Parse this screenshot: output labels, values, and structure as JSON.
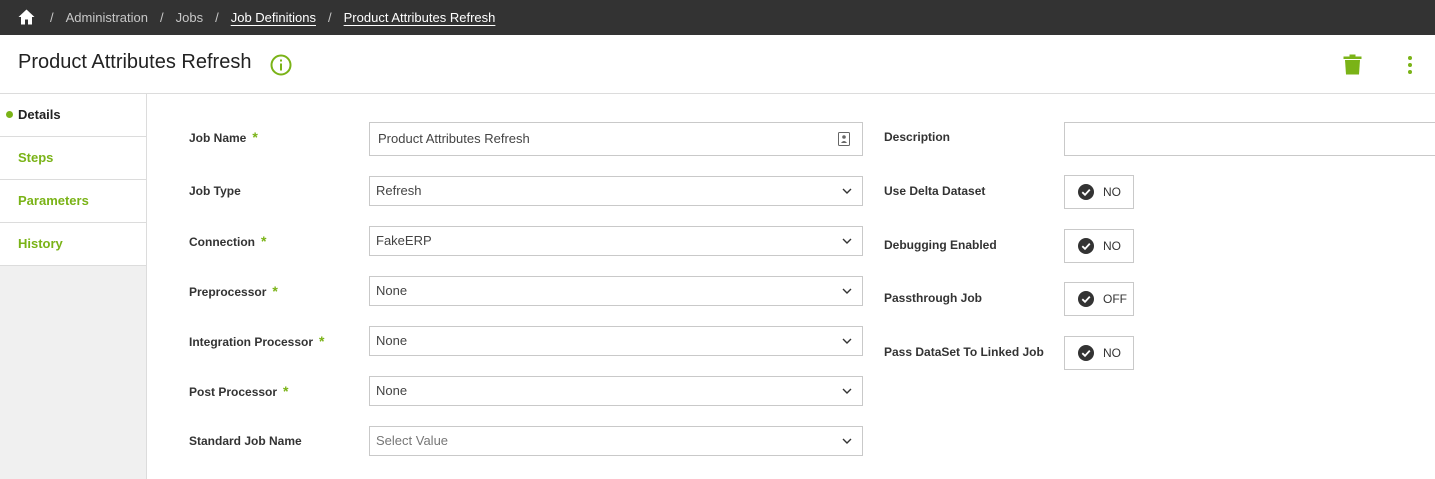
{
  "breadcrumb": {
    "items": [
      "Administration",
      "Jobs",
      "Job Definitions",
      "Product Attributes Refresh"
    ],
    "separator": "/"
  },
  "header": {
    "title": "Product Attributes Refresh"
  },
  "sidebar": {
    "items": [
      {
        "label": "Details"
      },
      {
        "label": "Steps"
      },
      {
        "label": "Parameters"
      },
      {
        "label": "History"
      }
    ]
  },
  "form": {
    "required_mark": "*",
    "job_name": {
      "label": "Job Name",
      "value": "Product Attributes Refresh"
    },
    "job_type": {
      "label": "Job Type",
      "value": "Refresh"
    },
    "connection": {
      "label": "Connection",
      "value": "FakeERP"
    },
    "preprocessor": {
      "label": "Preprocessor",
      "value": "None"
    },
    "integration_processor": {
      "label": "Integration Processor",
      "value": "None"
    },
    "post_processor": {
      "label": "Post Processor",
      "value": "None"
    },
    "standard_job_name": {
      "label": "Standard Job Name",
      "placeholder": "Select Value"
    },
    "description": {
      "label": "Description",
      "value": ""
    },
    "use_delta_dataset": {
      "label": "Use Delta Dataset",
      "value": "NO"
    },
    "debugging_enabled": {
      "label": "Debugging Enabled",
      "value": "NO"
    },
    "passthrough_job": {
      "label": "Passthrough Job",
      "value": "OFF"
    },
    "pass_dataset": {
      "label": "Pass DataSet To Linked Job",
      "value": "NO"
    }
  },
  "colors": {
    "accent": "#7ab317",
    "topbar": "#333333"
  },
  "icons": [
    "home-icon",
    "info-icon",
    "trash-icon",
    "more-vertical-icon",
    "contact-card-icon",
    "chevron-down-icon",
    "check-circle-icon"
  ]
}
